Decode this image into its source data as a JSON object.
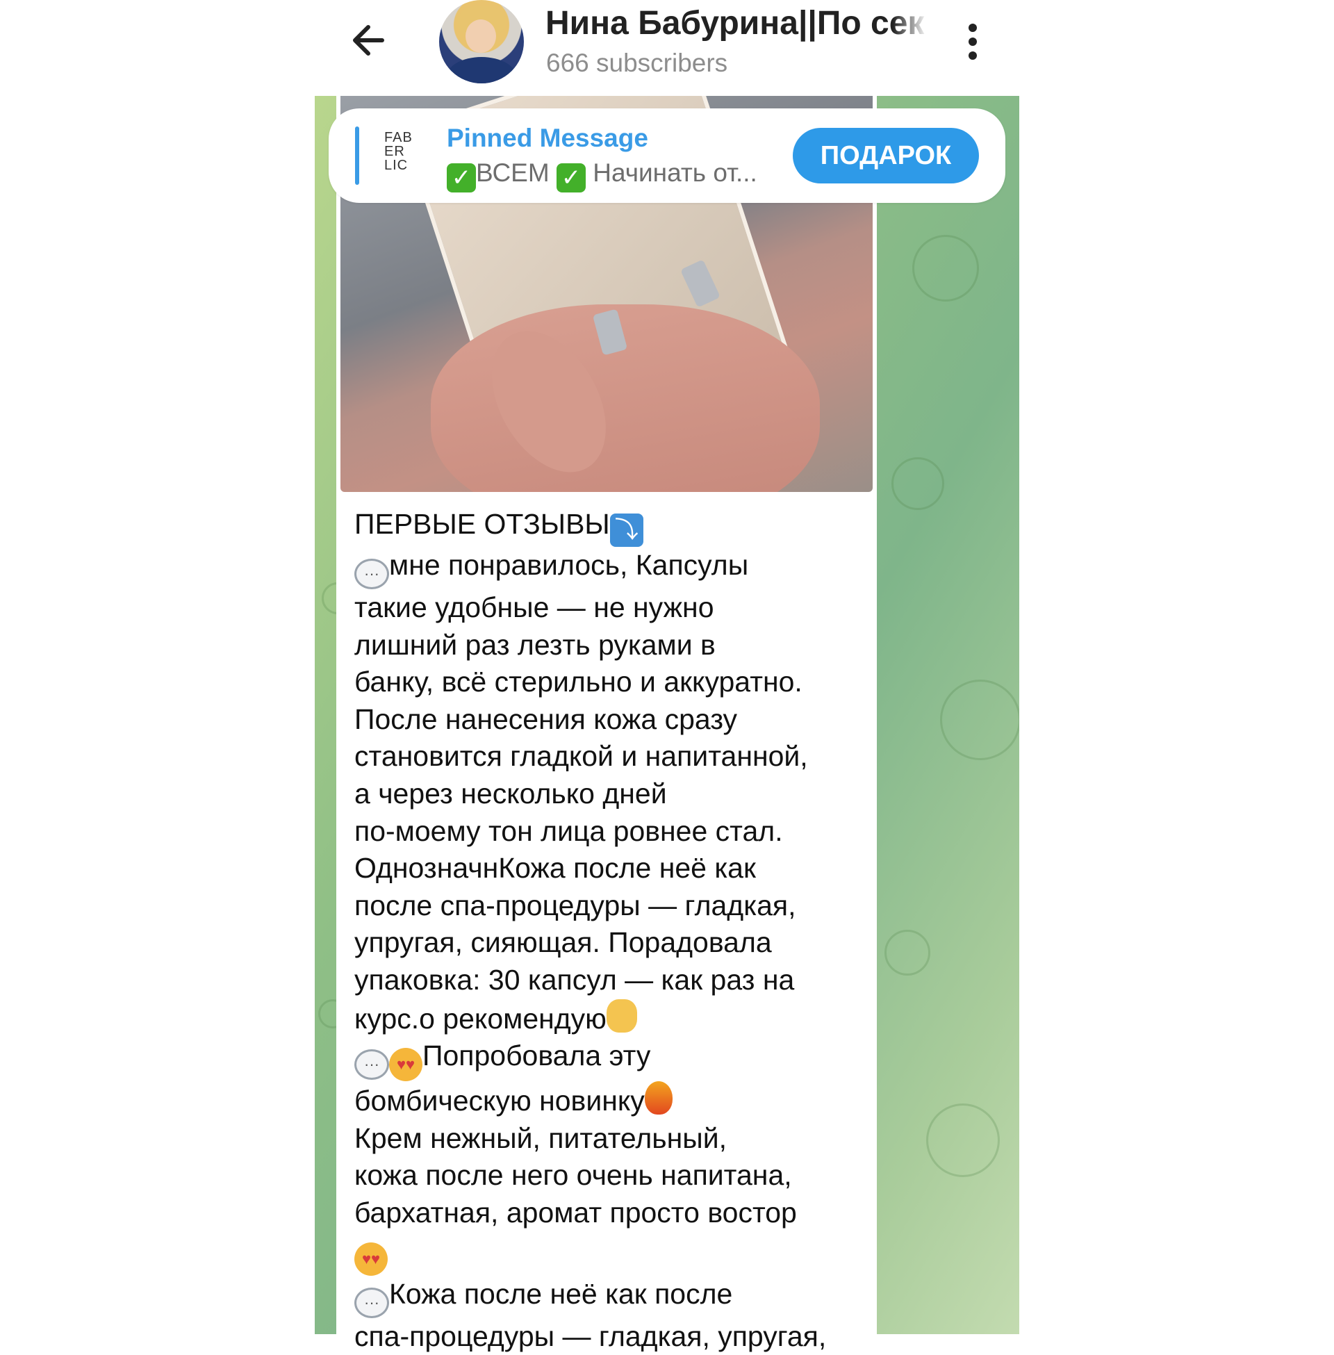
{
  "header": {
    "title": "Нина Бабурина||По сек",
    "subscribers": "666 subscribers"
  },
  "pinned": {
    "label": "Pinned Message",
    "logo_lines": [
      "FAB",
      "ER",
      "LIC"
    ],
    "preview_part1": "ВСЕМ",
    "preview_part2": "Начинать от...",
    "button_label": "ПОДАРОК"
  },
  "colors": {
    "accent": "#2e9ae8",
    "pinned_label": "#3a9be6",
    "chat_background": "#8fbf86"
  },
  "icons": {
    "back": "arrow-left-icon",
    "menu": "vertical-dots-icon",
    "check": "green-check-emoji",
    "speech": "speech-bubble-emoji"
  },
  "message": {
    "line_01": "ПЕРВЫЕ ОТЗЫВЫ",
    "line_02": "мне понравилось, Капсулы",
    "line_03": "такие удобные — не нужно",
    "line_04": "лишний раз лезть руками в",
    "line_05": "банку, всё стерильно и аккуратно.",
    "line_06": "После нанесения кожа сразу",
    "line_07": "становится гладкой и напитанной,",
    "line_08": "а через несколько дней",
    "line_09": "по-моему тон лица ровнее стал.",
    "line_10": "ОднозначнКожа после неё как",
    "line_11": "после спа-процедуры — гладкая,",
    "line_12": "упругая, сияющая. Порадовала",
    "line_13": "упаковка: 30 капсул — как раз на",
    "line_14": "курс.о рекомендую",
    "line_15": "Попробовала эту",
    "line_16": "бомбическую новинку",
    "line_17": "Крем нежный, питательный,",
    "line_18": "кожа после него очень напитана,",
    "line_19": "бархатная, аромат просто востор",
    "line_20": "Кожа после неё как после",
    "line_21": "спа-процедуры — гладкая, упругая,"
  }
}
